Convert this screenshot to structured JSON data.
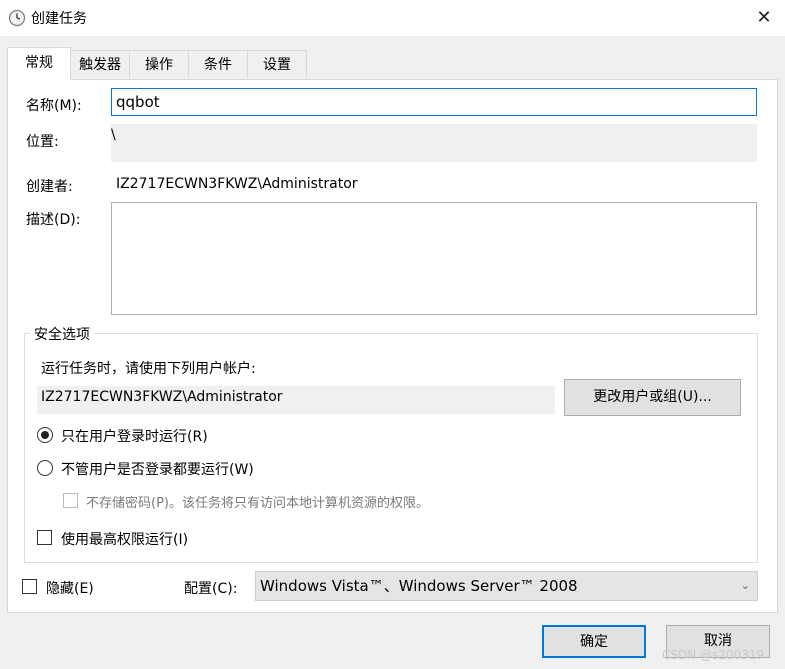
{
  "window": {
    "title": "创建任务",
    "close_symbol": "✕"
  },
  "tabs": [
    {
      "label": "常规",
      "active": true
    },
    {
      "label": "触发器",
      "active": false
    },
    {
      "label": "操作",
      "active": false
    },
    {
      "label": "条件",
      "active": false
    },
    {
      "label": "设置",
      "active": false
    }
  ],
  "general": {
    "name_label": "名称(M):",
    "name_value": "qqbot",
    "location_label": "位置:",
    "location_value": "\\",
    "author_label": "创建者:",
    "author_value": "IZ2717ECWN3FKWZ\\Administrator",
    "description_label": "描述(D):",
    "description_value": ""
  },
  "security": {
    "group_title": "安全选项",
    "run_as_prompt": "运行任务时，请使用下列用户帐户:",
    "account_value": "IZ2717ECWN3FKWZ\\Administrator",
    "change_user_button": "更改用户或组(U)...",
    "radio_logged_on": "只在用户登录时运行(R)",
    "radio_logged_on_selected": true,
    "radio_whether_logged_on": "不管用户是否登录都要运行(W)",
    "radio_whether_logged_on_selected": false,
    "no_store_password": "不存储密码(P)。该任务将只有访问本地计算机资源的权限。",
    "no_store_password_checked": false,
    "highest_privileges": "使用最高权限运行(I)",
    "highest_privileges_checked": false
  },
  "bottom": {
    "hidden_label": "隐藏(E)",
    "hidden_checked": false,
    "configure_label": "配置(C):",
    "configure_value": "Windows Vista™、Windows Server™ 2008"
  },
  "buttons": {
    "ok": "确定",
    "cancel": "取消"
  },
  "watermark": "CSDN @s200319",
  "colors": {
    "accent": "#0078d7",
    "background": "#f0f0f0",
    "panel": "#ffffff"
  }
}
